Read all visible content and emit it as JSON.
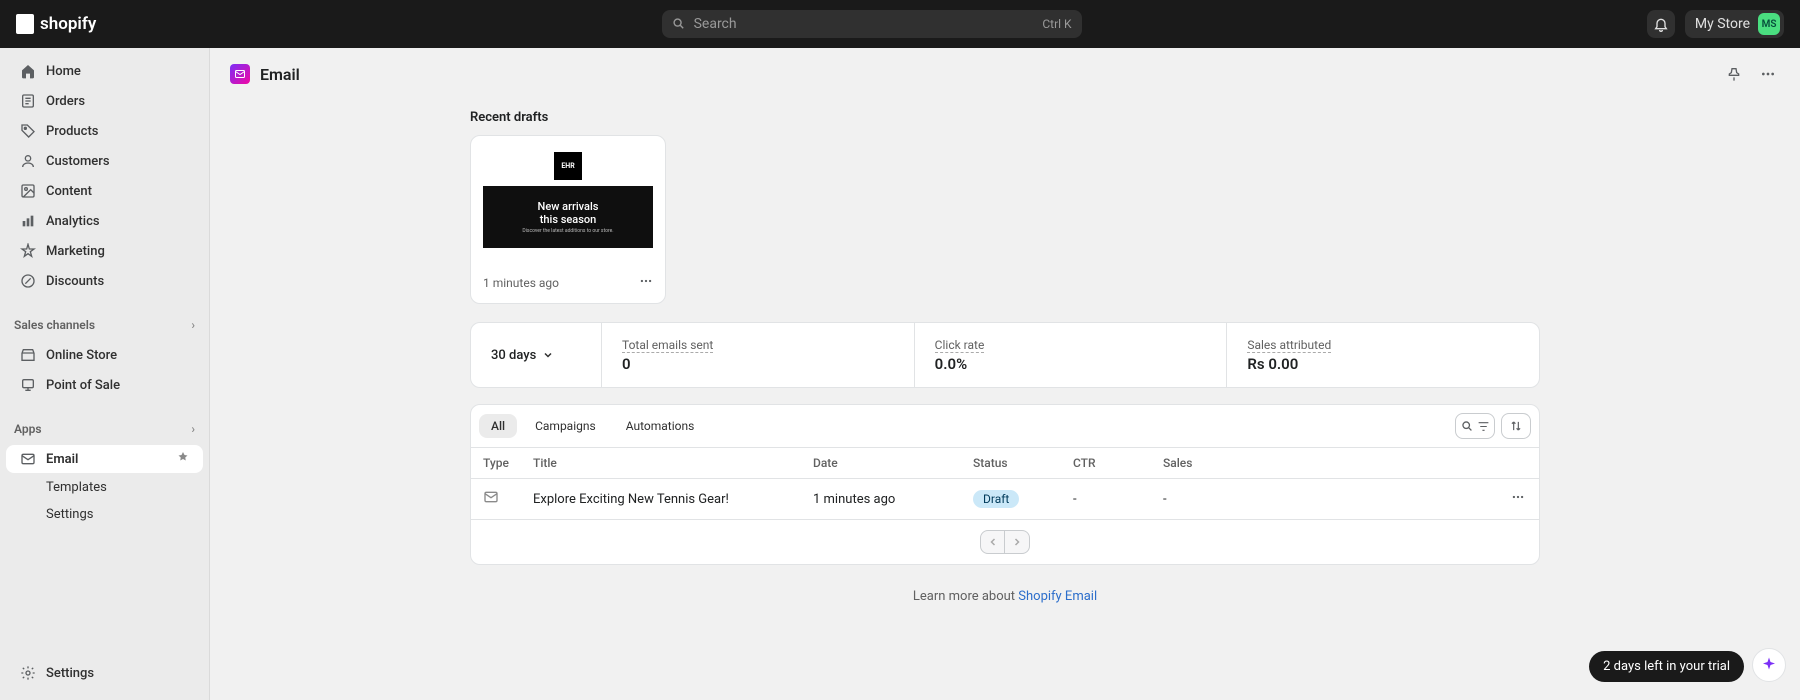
{
  "topbar": {
    "logo_text": "shopify",
    "search_placeholder": "Search",
    "shortcut_label": "Ctrl K",
    "store_name": "My Store",
    "avatar_initials": "MS"
  },
  "sidebar": {
    "items": [
      {
        "label": "Home",
        "icon": "home"
      },
      {
        "label": "Orders",
        "icon": "orders"
      },
      {
        "label": "Products",
        "icon": "products"
      },
      {
        "label": "Customers",
        "icon": "customers"
      },
      {
        "label": "Content",
        "icon": "content"
      },
      {
        "label": "Analytics",
        "icon": "analytics"
      },
      {
        "label": "Marketing",
        "icon": "marketing"
      },
      {
        "label": "Discounts",
        "icon": "discounts"
      }
    ],
    "sales_channels_label": "Sales channels",
    "sales_channels": [
      {
        "label": "Online Store"
      },
      {
        "label": "Point of Sale"
      }
    ],
    "apps_label": "Apps",
    "apps": [
      {
        "label": "Email",
        "active": true,
        "subitems": [
          "Templates",
          "Settings"
        ]
      }
    ],
    "settings_label": "Settings"
  },
  "page": {
    "title": "Email"
  },
  "recent_drafts": {
    "heading": "Recent drafts",
    "card": {
      "preview_title_line1": "New arrivals",
      "preview_title_line2": "this season",
      "preview_subtitle": "Discover the latest additions to our store.",
      "brand_mark": "EHR",
      "timestamp": "1 minutes ago"
    }
  },
  "stats": {
    "range_label": "30 days",
    "metrics": [
      {
        "label": "Total emails sent",
        "value": "0"
      },
      {
        "label": "Click rate",
        "value": "0.0%"
      },
      {
        "label": "Sales attributed",
        "value": "Rs 0.00"
      }
    ]
  },
  "table": {
    "tabs": [
      "All",
      "Campaigns",
      "Automations"
    ],
    "active_tab": "All",
    "columns": [
      "Type",
      "Title",
      "Date",
      "Status",
      "CTR",
      "Sales"
    ],
    "rows": [
      {
        "title": "Explore Exciting New Tennis Gear!",
        "date": "1 minutes ago",
        "status": "Draft",
        "ctr": "-",
        "sales": "-"
      }
    ]
  },
  "learn_more": {
    "prefix": "Learn more about ",
    "link_text": "Shopify Email"
  },
  "trial": {
    "label": "2 days left in your trial"
  }
}
